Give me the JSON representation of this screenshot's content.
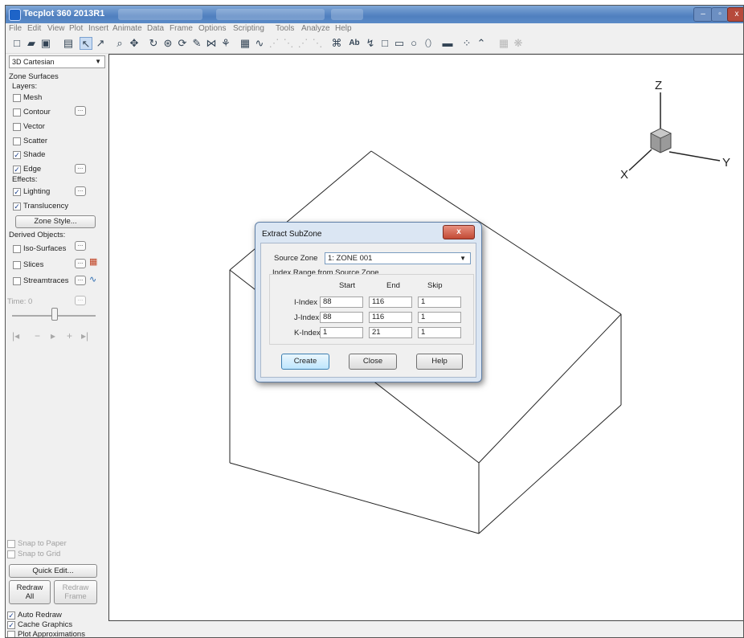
{
  "window": {
    "title": "Tecplot 360 2013R1",
    "minimize": "–",
    "maximize": "▫",
    "close": "x"
  },
  "menu": [
    "File",
    "Edit",
    "View",
    "Plot",
    "Insert",
    "Animate",
    "Data",
    "Frame",
    "Options",
    "Scripting",
    "Tools",
    "Analyze",
    "Help"
  ],
  "toolbar": {
    "text_tool": "Ab",
    "icons": [
      "new-icon",
      "open-icon",
      "save-icon",
      "print-icon",
      "select-arrow-icon",
      "adjust-icon",
      "zoom-icon",
      "translate-icon",
      "rotate-icon",
      "rollerball-icon",
      "spherical-rotate-icon",
      "probe-icon",
      "slice-icon",
      "extract-icon",
      "stream-icon",
      "dim-tool-1-icon",
      "dim-tool-2-icon",
      "dim-tool-3-icon",
      "dim-tool-4-icon",
      "geometry-icon",
      "text-icon",
      "polyline-icon",
      "square-icon",
      "rectangle-icon",
      "circle-icon",
      "ellipse-icon",
      "frame-icon",
      "scatter-icon",
      "line-icon",
      "grid-icon",
      "sphere-icon"
    ]
  },
  "sidebar": {
    "plot_type": "3D Cartesian",
    "zone_surfaces": "Zone Surfaces",
    "layers_label": "Layers:",
    "layers": [
      {
        "label": "Mesh",
        "checked": false
      },
      {
        "label": "Contour",
        "checked": false
      },
      {
        "label": "Vector",
        "checked": false
      },
      {
        "label": "Scatter",
        "checked": false
      },
      {
        "label": "Shade",
        "checked": true
      },
      {
        "label": "Edge",
        "checked": true
      }
    ],
    "effects_label": "Effects:",
    "effects": [
      {
        "label": "Lighting",
        "checked": true
      },
      {
        "label": "Translucency",
        "checked": true
      }
    ],
    "zone_style_button": "Zone Style...",
    "derived_label": "Derived Objects:",
    "derived": [
      {
        "label": "Iso-Surfaces",
        "checked": false
      },
      {
        "label": "Slices",
        "checked": false
      },
      {
        "label": "Streamtraces",
        "checked": false
      }
    ],
    "time_label": "Time: 0",
    "snap_paper": "Snap to Paper",
    "snap_grid": "Snap to Grid",
    "quick_edit": "Quick Edit...",
    "redraw_all": "Redraw\nAll",
    "redraw_frame": "Redraw\nFrame",
    "auto_redraw": {
      "label": "Auto Redraw",
      "checked": true
    },
    "cache_graphics": {
      "label": "Cache Graphics",
      "checked": true
    },
    "plot_approx": {
      "label": "Plot Approximations",
      "checked": false
    }
  },
  "axes": {
    "z": "Z",
    "x": "X",
    "y": "Y"
  },
  "dialog": {
    "title": "Extract SubZone",
    "close": "x",
    "source_zone_label": "Source Zone",
    "source_zone_value": "1: ZONE 001",
    "group_label": "Index Range from Source Zone",
    "columns": [
      "Start",
      "End",
      "Skip"
    ],
    "rows": [
      {
        "label": "I-Index",
        "start": "88",
        "end": "116",
        "skip": "1"
      },
      {
        "label": "J-Index",
        "start": "88",
        "end": "116",
        "skip": "1"
      },
      {
        "label": "K-Index",
        "start": "1",
        "end": "21",
        "skip": "1"
      }
    ],
    "buttons": {
      "create": "Create",
      "close": "Close",
      "help": "Help"
    }
  }
}
